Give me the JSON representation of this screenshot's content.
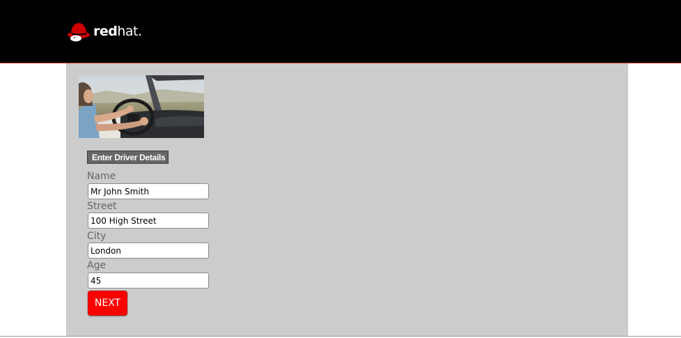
{
  "header": {
    "logo": {
      "icon": "redhat-shadowman-icon",
      "text_bold": "red",
      "text_light": "hat."
    }
  },
  "main": {
    "photo": {
      "icon": "driver-photo"
    },
    "form": {
      "heading": "Enter Driver Details",
      "fields": [
        {
          "label": "Name",
          "value": "Mr John Smith"
        },
        {
          "label": "Street",
          "value": "100 High Street"
        },
        {
          "label": "City",
          "value": "London"
        },
        {
          "label": "Age",
          "value": "45"
        }
      ],
      "next_label": "NEXT"
    }
  },
  "colors": {
    "header_bg": "#000000",
    "header_rule": "#c9452e",
    "panel_bg": "#cccccc",
    "heading_bg": "#666666",
    "label_text": "#666666",
    "button_bg": "#ff0000",
    "brand_red": "#cc0000"
  }
}
